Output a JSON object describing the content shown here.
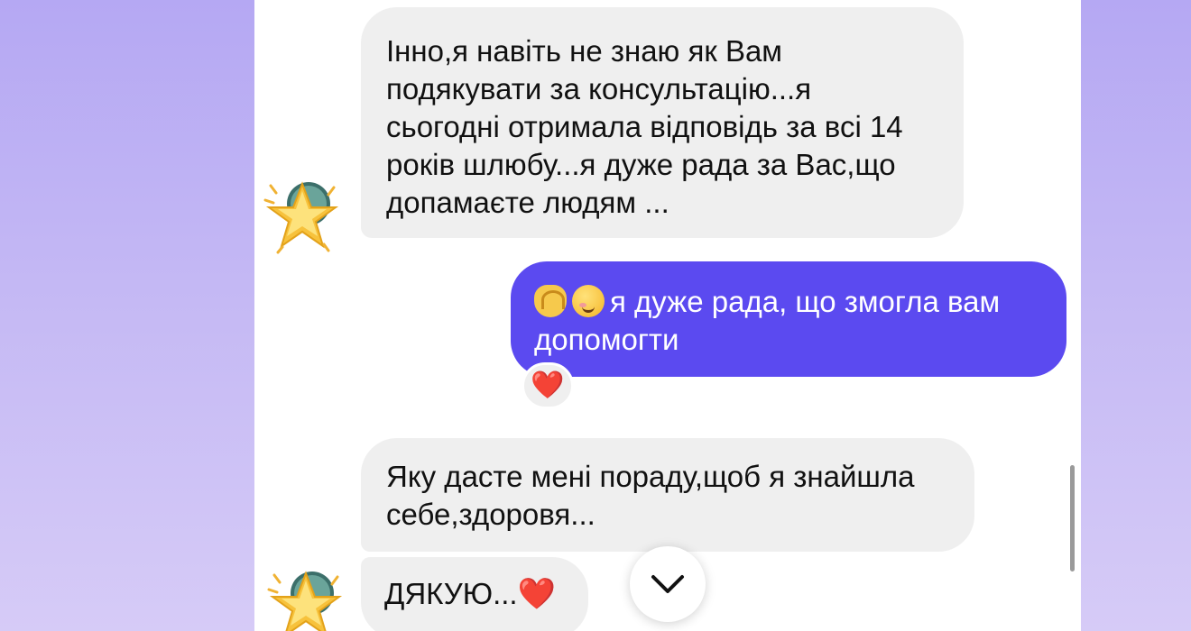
{
  "messages": [
    {
      "id": "msg1",
      "direction": "incoming",
      "text": "Інно,я навіть не знаю як Вам\nподякувати за консультацію...я\nсьогодні отримала відповідь за всі 14\nроків шлюбу...я дуже рада за Вас,що\nдопамаєте людям ..."
    },
    {
      "id": "msg2",
      "direction": "outgoing",
      "emojis": [
        "heart-hands-icon",
        "smiling-face-icon"
      ],
      "text": "я дуже рада, що змогла вам\nдопомогти",
      "reaction": "❤️"
    },
    {
      "id": "msg3",
      "direction": "incoming",
      "text": "Яку дасте мені пораду,щоб я знайшла\nсебе,здоровя..."
    },
    {
      "id": "msg4",
      "direction": "incoming",
      "text": "ДЯКУЮ...",
      "trailing_emoji": "❤️"
    }
  ],
  "avatar_icon": "star-emoji-avatar",
  "scroll_down_icon": "chevron-down-icon",
  "colors": {
    "background_top": "#b5a8f3",
    "background_bottom": "#d6cbf7",
    "incoming_bubble": "#efefef",
    "outgoing_bubble": "#5b4af0",
    "heart": "#e8253a"
  }
}
